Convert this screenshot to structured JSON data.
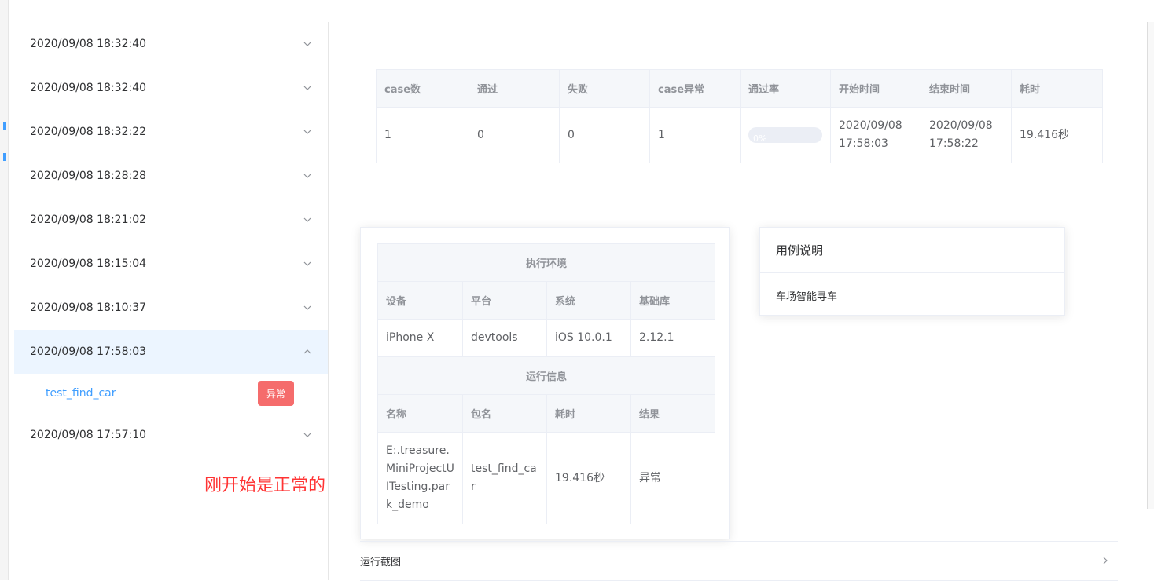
{
  "sidebar": {
    "items": [
      {
        "label": "2020/09/08 18:32:40",
        "expanded": false
      },
      {
        "label": "2020/09/08 18:32:40",
        "expanded": false
      },
      {
        "label": "2020/09/08 18:32:22",
        "expanded": false
      },
      {
        "label": "2020/09/08 18:28:28",
        "expanded": false
      },
      {
        "label": "2020/09/08 18:21:02",
        "expanded": false
      },
      {
        "label": "2020/09/08 18:15:04",
        "expanded": false
      },
      {
        "label": "2020/09/08 18:10:37",
        "expanded": false
      },
      {
        "label": "2020/09/08 17:58:03",
        "expanded": true,
        "sub_label": "test_find_car",
        "sub_badge": "异常"
      },
      {
        "label": "2020/09/08 17:57:10",
        "expanded": false
      }
    ]
  },
  "annotation": "刚开始是正常的",
  "summary": {
    "headers": [
      "case数",
      "通过",
      "失败",
      "case异常",
      "通过率",
      "开始时间",
      "结束时间",
      "耗时"
    ],
    "row": {
      "cases": "1",
      "passed": "0",
      "failed": "0",
      "errors": "1",
      "pass_rate_label": "0%",
      "pass_rate": 0,
      "start": "2020/09/08 17:58:03",
      "end": "2020/09/08 17:58:22",
      "duration": "19.416秒"
    }
  },
  "env": {
    "title": "执行环境",
    "headers": [
      "设备",
      "平台",
      "系统",
      "基础库"
    ],
    "values": [
      "iPhone X",
      "devtools",
      "iOS 10.0.1",
      "2.12.1"
    ],
    "run_title": "运行信息",
    "run_headers": [
      "名称",
      "包名",
      "耗时",
      "结果"
    ],
    "run_values": [
      "E:.treasure.MiniProjectUITesting.park_demo",
      "test_find_car",
      "19.416秒",
      "异常"
    ]
  },
  "desc": {
    "title": "用例说明",
    "body": "车场智能寻车"
  },
  "screenshots": {
    "label": "运行截图"
  },
  "colors": {
    "accent": "#409eff",
    "danger": "#f56c6c",
    "active_bg": "#ecf5ff",
    "annotation": "#ff3333"
  }
}
